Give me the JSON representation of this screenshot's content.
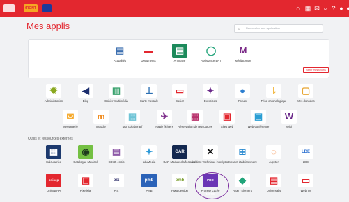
{
  "topbar": {
    "logo_text": "fRONT",
    "colors": {
      "bar": "#e3272f"
    },
    "icons": [
      "home-icon",
      "grid-icon",
      "mail-icon",
      "search-icon",
      "help-icon",
      "user-icon",
      "avatar-icon"
    ]
  },
  "page": {
    "title": "Mes applis",
    "search_placeholder": "Rechercher une application",
    "manage_favs_label": "Gérer mes favoris",
    "section_title": "Outils et ressources externes"
  },
  "favorites": [
    {
      "label": "Actualités",
      "icon": "news-icon"
    },
    {
      "label": "Documents",
      "icon": "folder-icon"
    },
    {
      "label": "Annuaire",
      "icon": "contacts-icon"
    },
    {
      "label": "Assistance ENT",
      "icon": "headset-icon"
    },
    {
      "label": "Médiacentre",
      "icon": "mediacentre-icon"
    }
  ],
  "apps_row1": [
    {
      "label": "Administration",
      "icon": "gears-icon"
    },
    {
      "label": "Blog",
      "icon": "megaphone-icon"
    },
    {
      "label": "Cahier multimédia",
      "icon": "notebook-icon"
    },
    {
      "label": "Carte mentale",
      "icon": "mindmap-icon"
    },
    {
      "label": "Casier",
      "icon": "inbox-icon"
    },
    {
      "label": "Exercices",
      "icon": "exercises-icon"
    },
    {
      "label": "Forum",
      "icon": "chat-icon"
    },
    {
      "label": "Frise chronologique",
      "icon": "timeline-icon"
    },
    {
      "label": "Mes données",
      "icon": "data-icon"
    }
  ],
  "apps_row2": [
    {
      "label": "Messagerie",
      "icon": "envelope-icon"
    },
    {
      "label": "Moodle",
      "icon": "moodle-icon"
    },
    {
      "label": "Mur collaboratif",
      "icon": "wall-icon"
    },
    {
      "label": "Partie fichiers",
      "icon": "share-icon"
    },
    {
      "label": "Réservation de ressources",
      "icon": "calendar-icon"
    },
    {
      "label": "Sites web",
      "icon": "website-icon"
    },
    {
      "label": "Web-conférence",
      "icon": "webconf-icon"
    },
    {
      "label": "Wiki",
      "icon": "wiki-icon"
    }
  ],
  "external_row1": [
    {
      "label": "Calculatrice",
      "icon": "calculator-icon"
    },
    {
      "label": "Catalogue Maxicoll",
      "icon": "maxicoll-icon"
    },
    {
      "label": "CDI45 enbis",
      "icon": "cdi-icon"
    },
    {
      "label": "eduMedia",
      "icon": "edumedia-icon"
    },
    {
      "label": "GAR Module d'affectation",
      "icon": "gar-icon",
      "tile_text": "GAR"
    },
    {
      "label": "Incident Technique inscription",
      "icon": "tools-icon"
    },
    {
      "label": "Intranet établissement",
      "icon": "intranet-icon"
    },
    {
      "label": "Jupyter",
      "icon": "jupyter-icon"
    },
    {
      "label": "LDE",
      "icon": "lde-icon",
      "tile_text": "LDE"
    }
  ],
  "external_row2": [
    {
      "label": "Onisep RA",
      "icon": "onisep-icon",
      "tile_text": "onisep"
    },
    {
      "label": "Pixelisite",
      "icon": "pixelisite-icon"
    },
    {
      "label": "PIX",
      "icon": "pix-icon",
      "tile_text": "pix"
    },
    {
      "label": "PMB",
      "icon": "pmb-icon",
      "tile_text": "pmb"
    },
    {
      "label": "PMB gestion",
      "icon": "pmb-gestion-icon",
      "tile_text": "pmb"
    },
    {
      "label": "Pronote Lycée",
      "icon": "pronote-icon",
      "tile_text": "PRO NOTE"
    },
    {
      "label": "Rion - Elément",
      "icon": "element-icon"
    },
    {
      "label": "Universalis",
      "icon": "universalis-icon"
    },
    {
      "label": "Web TV",
      "icon": "webtv-icon"
    }
  ]
}
